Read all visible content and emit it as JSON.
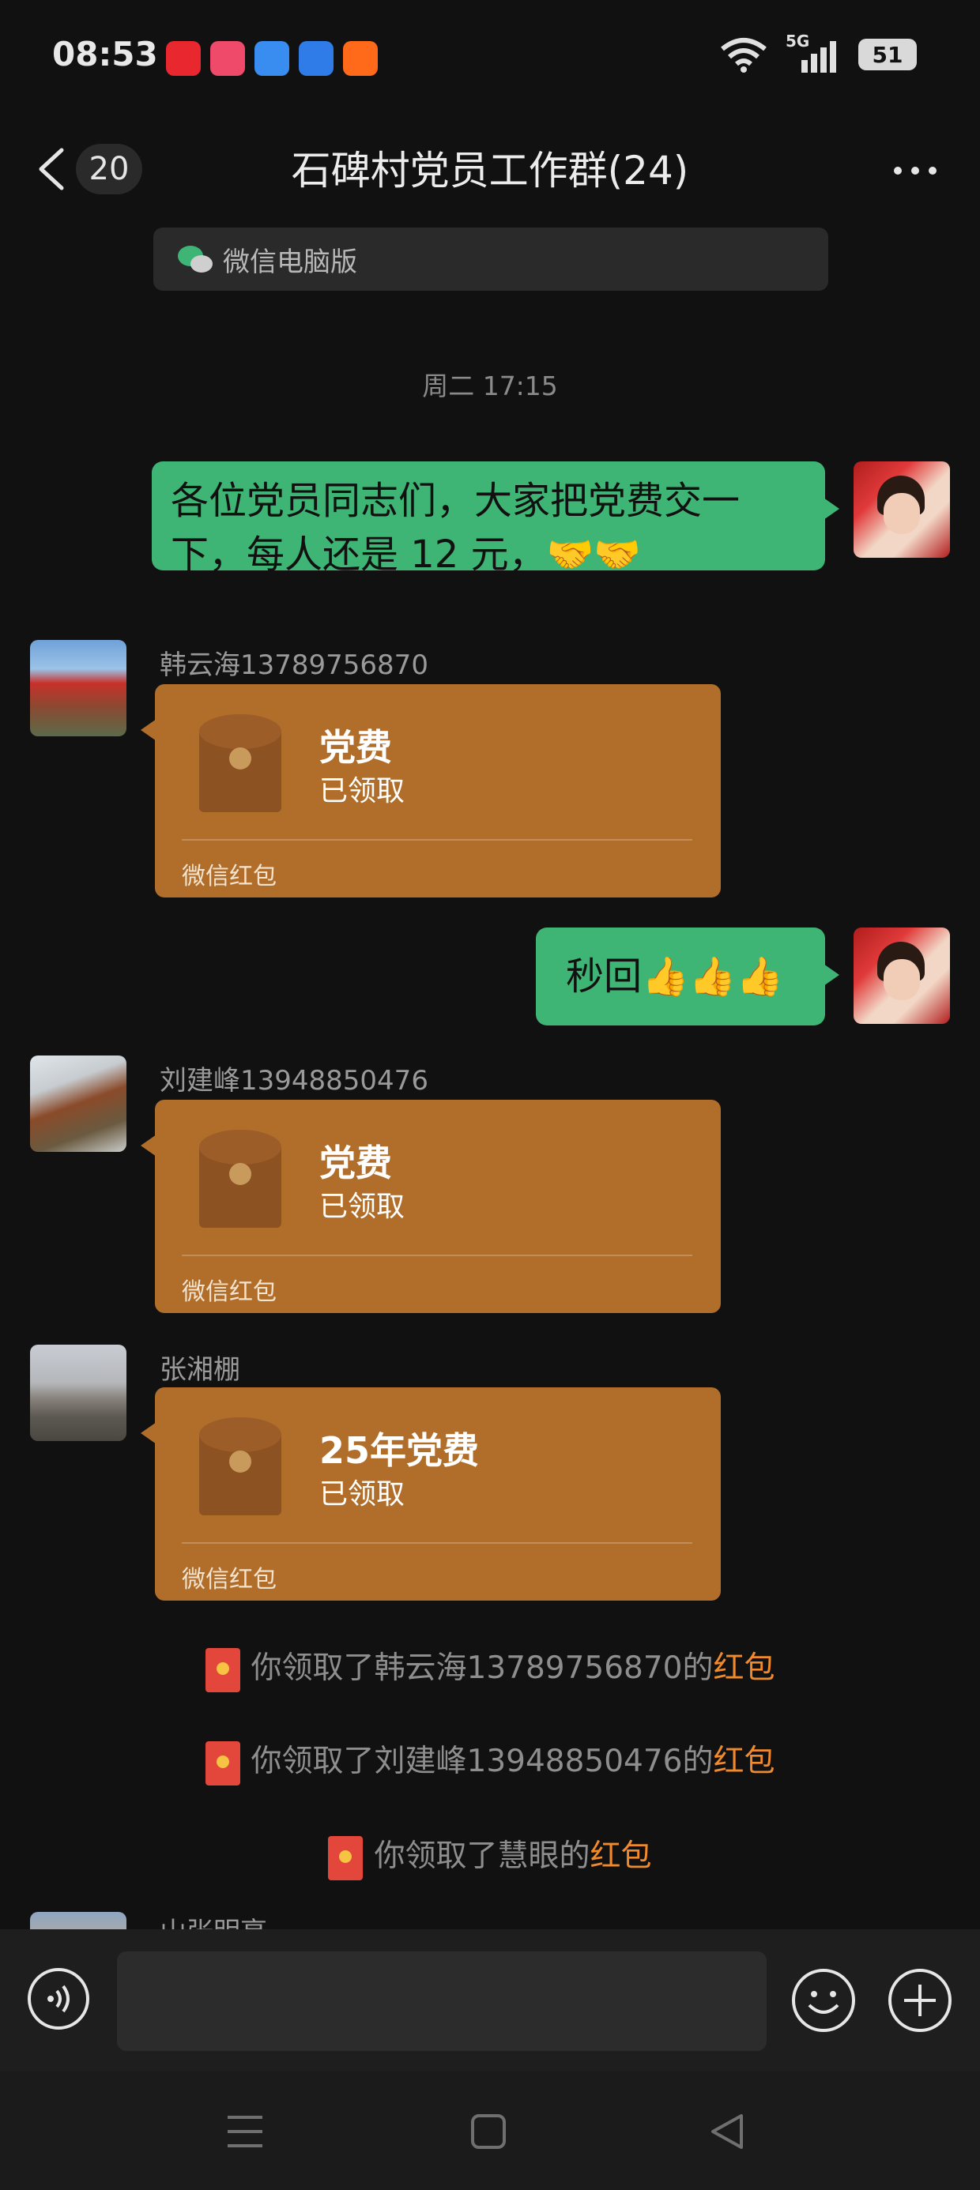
{
  "status_bar": {
    "time": "08:53",
    "network": "5G",
    "battery": "51"
  },
  "header": {
    "unread_count": "20",
    "title": "石碑村党员工作群(24)"
  },
  "pc_banner": {
    "label": "微信电脑版"
  },
  "timestamp": "周二 17:15",
  "messages": [
    {
      "type": "text",
      "outgoing": true,
      "text_line1": "各位党员同志们，大家把党费交一",
      "text_line2": "下，每人还是 12 元，🤝🤝"
    },
    {
      "type": "red_packet",
      "sender": "韩云海13789756870",
      "title": "党费",
      "status": "已领取",
      "label": "微信红包"
    },
    {
      "type": "text",
      "outgoing": true,
      "text": "秒回👍👍👍"
    },
    {
      "type": "red_packet",
      "sender": "刘建峰13948850476",
      "title": "党费",
      "status": "已领取",
      "label": "微信红包"
    },
    {
      "type": "red_packet",
      "sender": "张湘棚",
      "title": "25年党费",
      "status": "已领取",
      "label": "微信红包"
    }
  ],
  "notices": [
    {
      "prefix": "你领取了韩云海13789756870的",
      "link": "红包"
    },
    {
      "prefix": "你领取了刘建峰13948850476的",
      "link": "红包"
    },
    {
      "prefix": "你领取了慧眼的",
      "link": "红包"
    }
  ],
  "partial_sender": "山张明亮",
  "colors": {
    "bubble_green": "#3eb574",
    "red_packet": "#b06e2a",
    "highlight": "#f08a2c"
  }
}
